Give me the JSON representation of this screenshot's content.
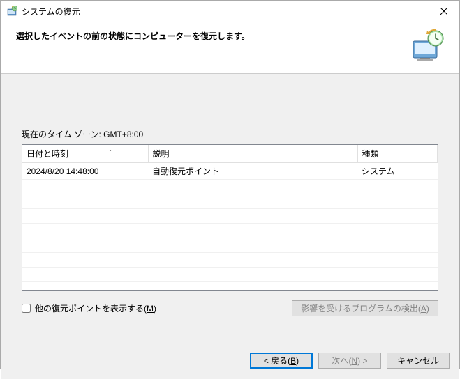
{
  "titlebar": {
    "title": "システムの復元"
  },
  "header": {
    "heading": "選択したイベントの前の状態にコンピューターを復元します。"
  },
  "content": {
    "timezone_label": "現在のタイム ゾーン: GMT+8:00",
    "columns": {
      "date": "日付と時刻",
      "description": "説明",
      "type": "種類"
    },
    "rows": [
      {
        "date": "2024/8/20 14:48:00",
        "description": "自動復元ポイント",
        "type": "システム"
      }
    ],
    "show_more_label_pre": "他の復元ポイントを表示する(",
    "show_more_accel": "M",
    "show_more_label_post": ")",
    "scan_button_pre": "影響を受けるプログラムの検出(",
    "scan_button_accel": "A",
    "scan_button_post": ")"
  },
  "footer": {
    "back_pre": "< 戻る(",
    "back_accel": "B",
    "back_post": ")",
    "next_pre": "次へ(",
    "next_accel": "N",
    "next_post": ") >",
    "cancel": "キャンセル"
  }
}
